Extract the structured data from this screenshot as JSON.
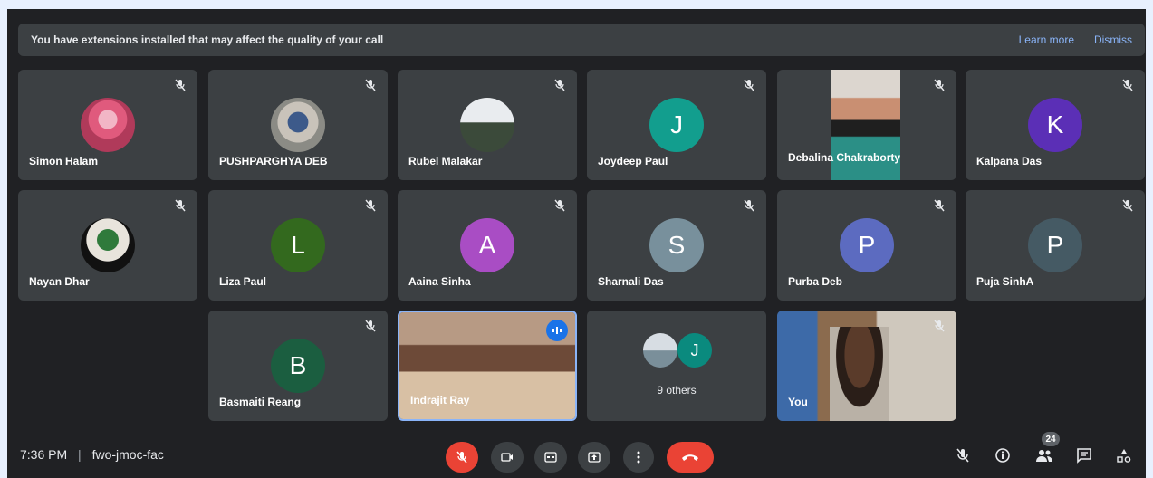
{
  "banner": {
    "message": "You have extensions installed that may affect the quality of your call",
    "learn_more": "Learn more",
    "dismiss": "Dismiss"
  },
  "participants": [
    {
      "name": "Simon Halam",
      "initial": "",
      "color": ""
    },
    {
      "name": "PUSHPARGHYA DEB",
      "initial": "",
      "color": ""
    },
    {
      "name": "Rubel Malakar",
      "initial": "",
      "color": ""
    },
    {
      "name": "Joydeep Paul",
      "initial": "J",
      "color": "#129e8e"
    },
    {
      "name": "Debalina Chakraborty",
      "initial": "",
      "color": ""
    },
    {
      "name": "Kalpana Das",
      "initial": "K",
      "color": "#5b2fb6"
    },
    {
      "name": "Nayan Dhar",
      "initial": "",
      "color": ""
    },
    {
      "name": "Liza Paul",
      "initial": "L",
      "color": "#33691e"
    },
    {
      "name": "Aaina Sinha",
      "initial": "A",
      "color": "#a94dc4"
    },
    {
      "name": "Sharnali Das",
      "initial": "S",
      "color": "#78909c"
    },
    {
      "name": "Purba Deb",
      "initial": "P",
      "color": "#5c6bc0"
    },
    {
      "name": "Puja SinhA",
      "initial": "P",
      "color": "#455a64"
    },
    {
      "name": "Basmaiti Reang",
      "initial": "B",
      "color": "#1b5e40"
    },
    {
      "name": "Indrajit Ray",
      "initial": "",
      "color": ""
    },
    {
      "name": "9 others",
      "initial": "J",
      "color": "#0a8a7e"
    },
    {
      "name": "You",
      "initial": "",
      "color": ""
    }
  ],
  "meeting": {
    "time": "7:36 PM",
    "separator": "|",
    "code": "fwo-jmoc-fac"
  },
  "people_count": "24",
  "colors": {
    "background": "#202124",
    "tile": "#3c4043",
    "hangup": "#ea4335",
    "accent": "#8ab4f8"
  }
}
